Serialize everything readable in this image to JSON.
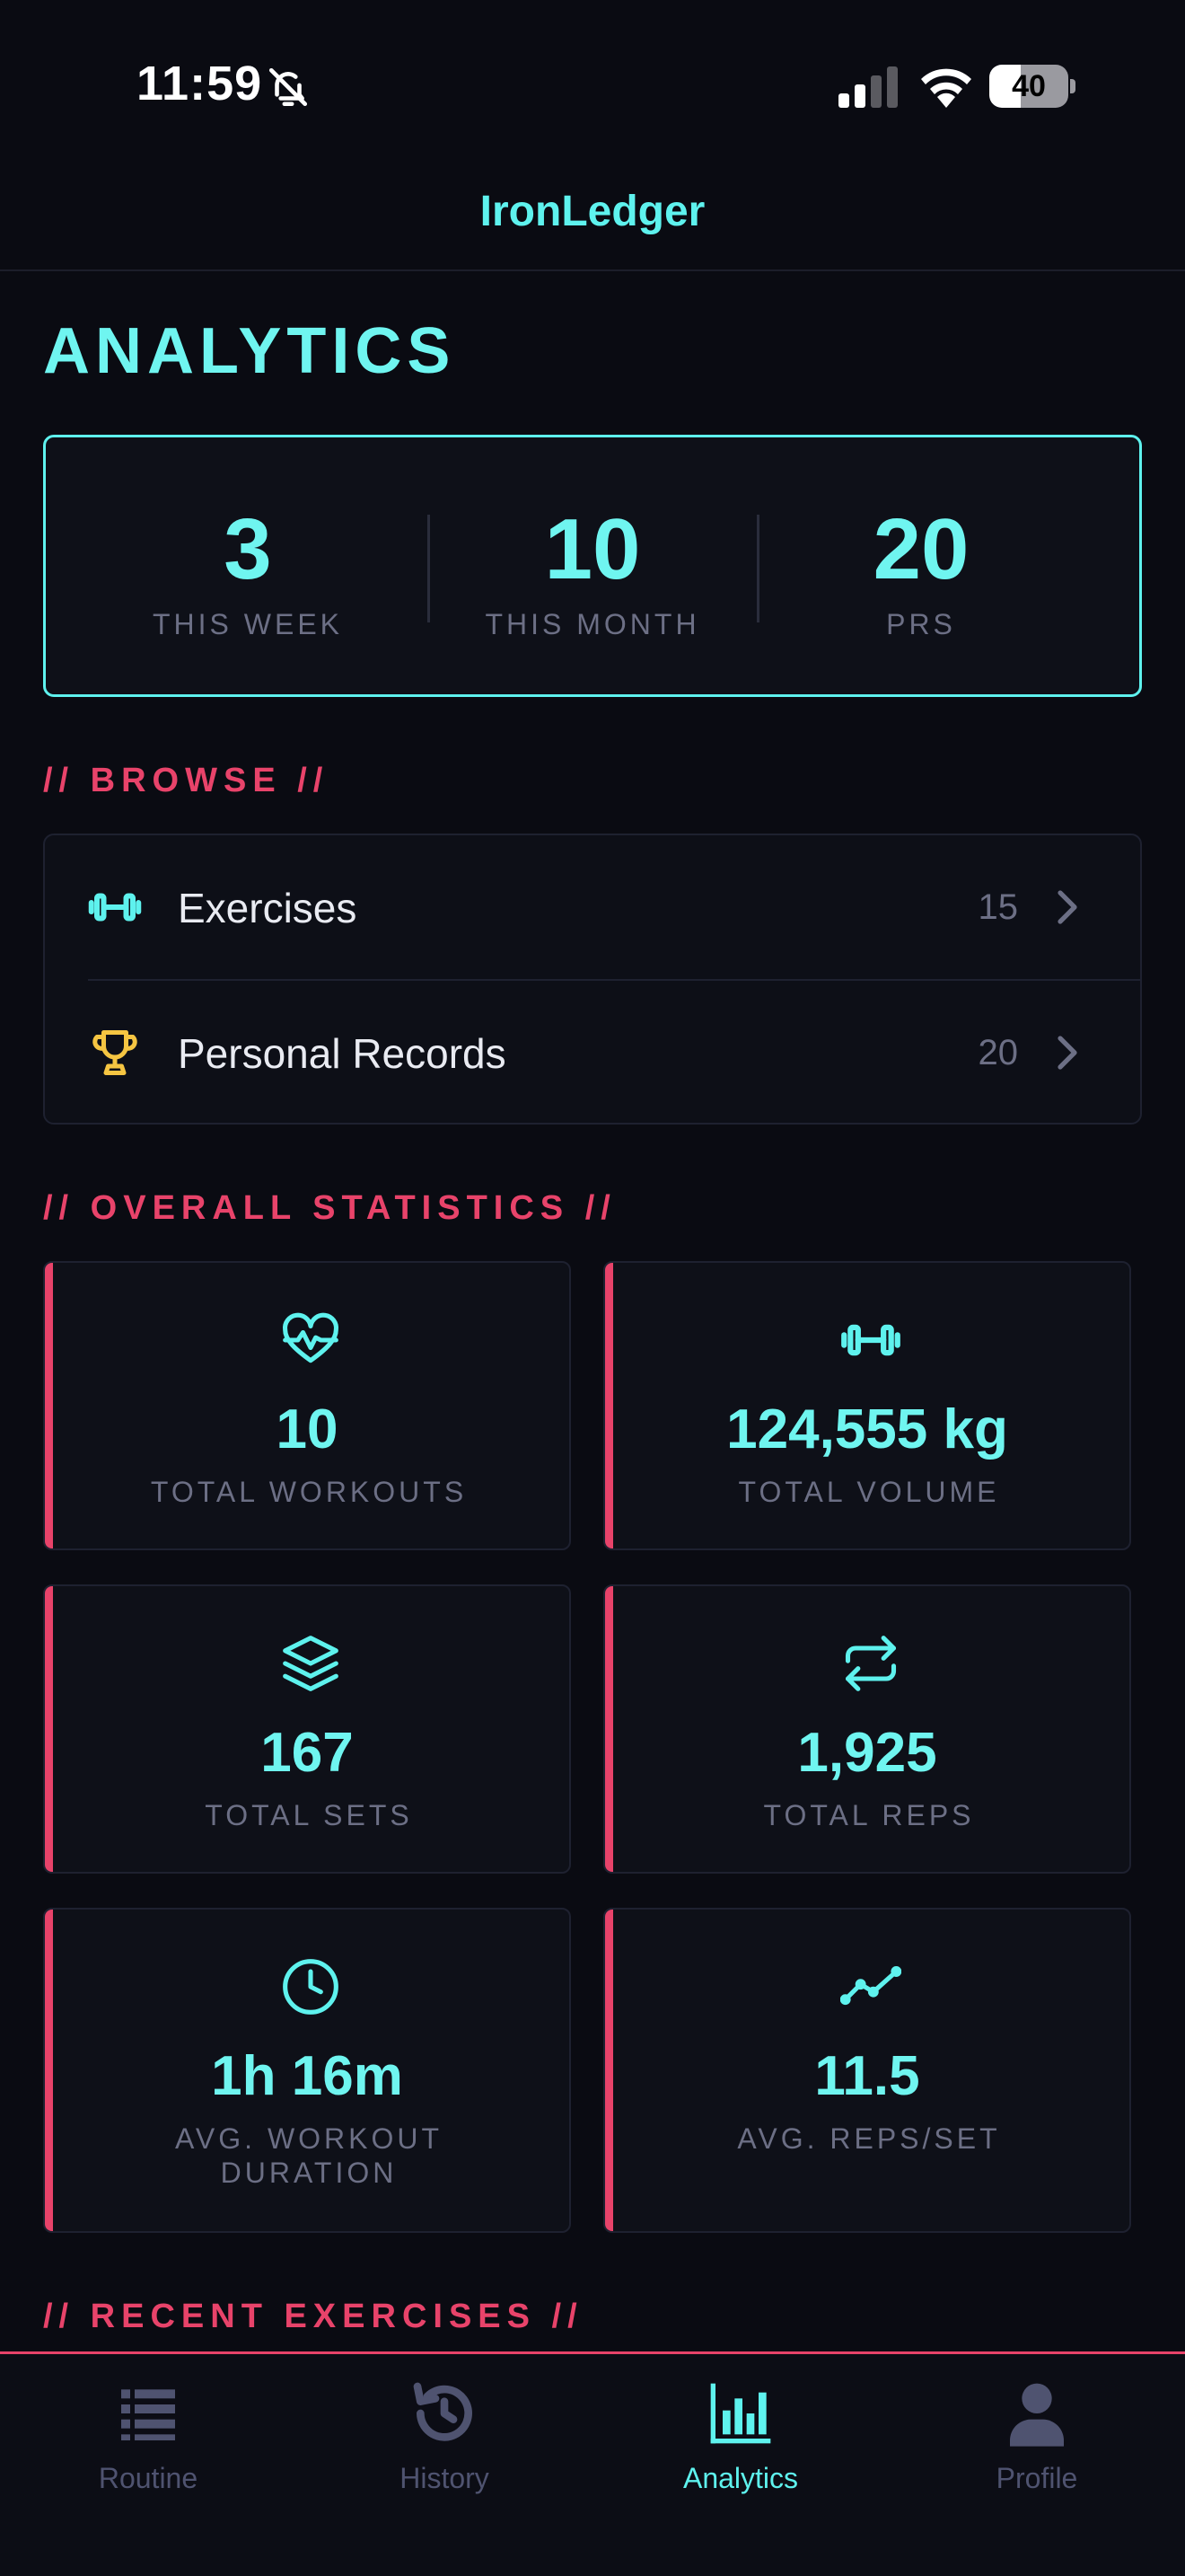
{
  "status_bar": {
    "time": "11:59",
    "battery": "40",
    "battery_level": 0.4
  },
  "app_title": "IronLedger",
  "page_title": "ANALYTICS",
  "summary": [
    {
      "value": "3",
      "label": "THIS WEEK"
    },
    {
      "value": "10",
      "label": "THIS MONTH"
    },
    {
      "value": "20",
      "label": "PRS"
    }
  ],
  "sections": {
    "browse": "// BROWSE //",
    "overall": "// OVERALL STATISTICS //",
    "recent": "// RECENT EXERCISES //"
  },
  "browse": [
    {
      "label": "Exercises",
      "count": "15",
      "icon": "dumbbell-icon"
    },
    {
      "label": "Personal Records",
      "count": "20",
      "icon": "trophy-icon"
    }
  ],
  "stats": [
    {
      "value": "10",
      "label": "TOTAL WORKOUTS",
      "icon": "heart-pulse-icon"
    },
    {
      "value": "124,555 kg",
      "label": "TOTAL VOLUME",
      "icon": "dumbbell-icon"
    },
    {
      "value": "167",
      "label": "TOTAL SETS",
      "icon": "layers-icon"
    },
    {
      "value": "1,925",
      "label": "TOTAL REPS",
      "icon": "repeat-icon"
    },
    {
      "value": "1h 16m",
      "label": "AVG. WORKOUT DURATION",
      "icon": "clock-icon"
    },
    {
      "value": "11.5",
      "label": "AVG. REPS/SET",
      "icon": "trend-line-icon"
    }
  ],
  "nav": [
    {
      "label": "Routine",
      "icon": "list-icon",
      "active": false
    },
    {
      "label": "History",
      "icon": "history-icon",
      "active": false
    },
    {
      "label": "Analytics",
      "icon": "bar-chart-icon",
      "active": true
    },
    {
      "label": "Profile",
      "icon": "person-icon",
      "active": false
    }
  ],
  "colors": {
    "accent": "#5ef2ee",
    "highlight": "#e8436a",
    "trophy": "#f5c542",
    "background": "#0a0b12",
    "muted": "#6c6f85"
  }
}
